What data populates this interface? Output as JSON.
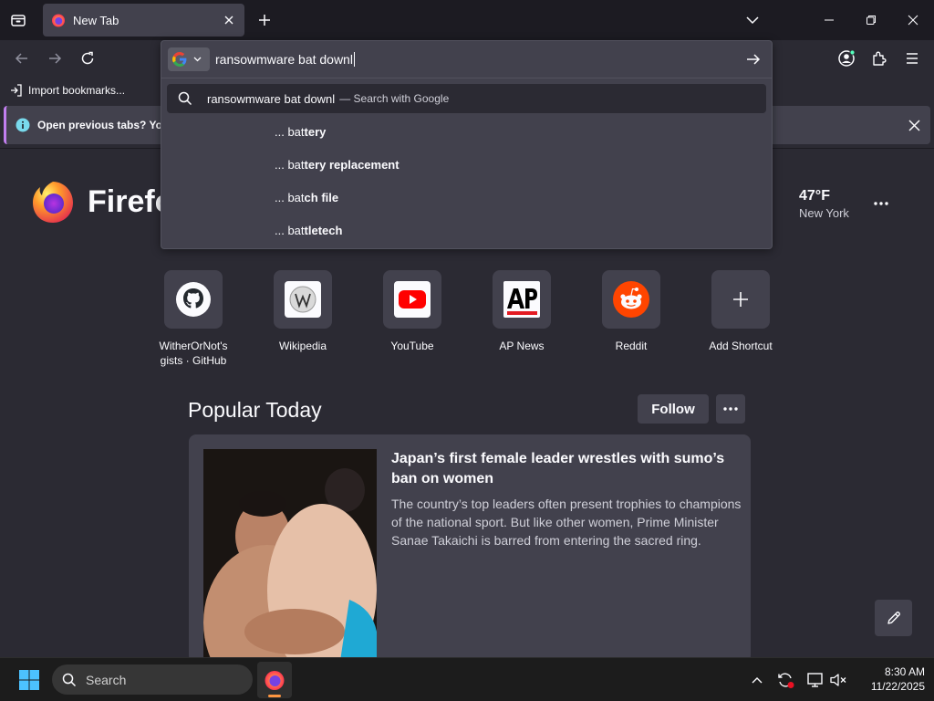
{
  "browser": {
    "tab": {
      "title": "New Tab"
    },
    "url": {
      "value": "ransowmware bat downl"
    },
    "bookmarks": {
      "import_label": "Import bookmarks..."
    },
    "notification": {
      "text": "Open previous tabs? You c"
    }
  },
  "dropdown": {
    "primary": {
      "query": "ransowmware bat downl",
      "suffix": "— Search with Google"
    },
    "suggestions": [
      {
        "prefix": "... bat",
        "rest": "tery"
      },
      {
        "prefix": "... bat",
        "rest": "tery replacement"
      },
      {
        "prefix": "... bat",
        "rest": "ch file"
      },
      {
        "prefix": "... bat",
        "rest": "tletech"
      }
    ]
  },
  "newtab": {
    "logo_text": "Firefo",
    "weather": {
      "temp": "47°F",
      "city": "New York"
    },
    "shortcuts": [
      {
        "label": "WitherOrNot's gists · GitHub",
        "icon": "github-icon"
      },
      {
        "label": "Wikipedia",
        "icon": "wikipedia-icon"
      },
      {
        "label": "YouTube",
        "icon": "youtube-icon"
      },
      {
        "label": "AP News",
        "icon": "ap-news-icon"
      },
      {
        "label": "Reddit",
        "icon": "reddit-icon"
      },
      {
        "label": "Add Shortcut",
        "icon": "plus-icon"
      }
    ],
    "popular": {
      "heading": "Popular Today",
      "follow_label": "Follow",
      "article": {
        "title": "Japan’s first female leader wrestles with sumo’s ban on women",
        "excerpt": "The country’s top leaders often present trophies to champions of the national sport. But like other women, Prime Minister Sanae Takaichi is barred from entering the sacred ring."
      }
    }
  },
  "taskbar": {
    "search_placeholder": "Search",
    "time": "8:30 AM",
    "date": "11/22/2025"
  },
  "colors": {
    "accent": "#c27ff0",
    "panel": "#42414d",
    "background": "#2b2a33",
    "chrome": "#1c1b22"
  }
}
